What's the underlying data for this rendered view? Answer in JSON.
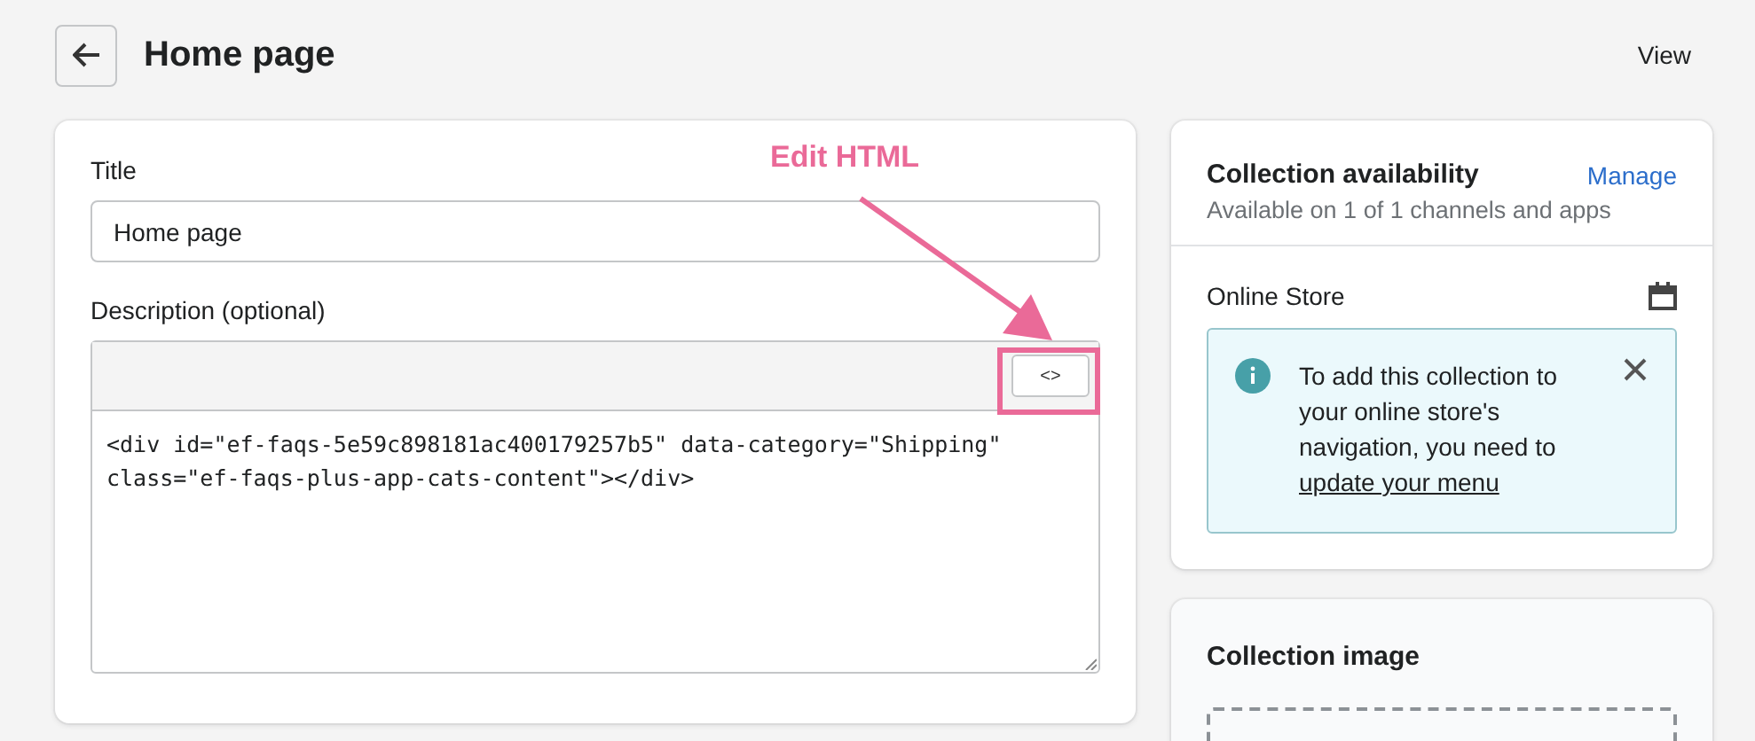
{
  "header": {
    "title": "Home page",
    "view_label": "View"
  },
  "main_card": {
    "title_label": "Title",
    "title_value": "Home page",
    "description_label": "Description (optional)",
    "html_toggle": "<>",
    "description_value": "<div id=\"ef-faqs-5e59c898181ac400179257b5\" data-category=\"Shipping\" class=\"ef-faqs-plus-app-cats-content\"></div>"
  },
  "annotation": {
    "text": "Edit HTML"
  },
  "availability": {
    "title": "Collection availability",
    "manage": "Manage",
    "subtitle": "Available on 1 of 1 channels and apps",
    "channel": "Online Store",
    "notice": {
      "text": "To add this collection to your online store's navigation, you need to ",
      "link": "update your menu"
    }
  },
  "image_card": {
    "title": "Collection image"
  }
}
